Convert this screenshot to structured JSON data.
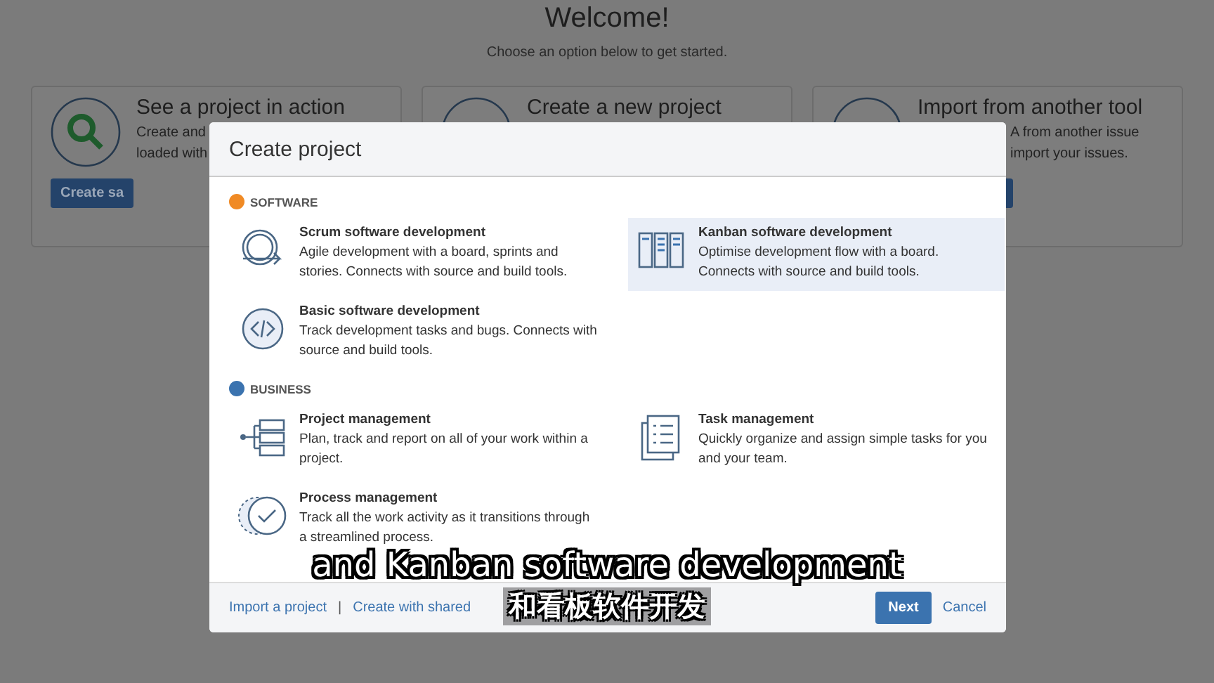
{
  "page": {
    "title": "Welcome!",
    "subtitle": "Choose an option below to get started.",
    "cards": [
      {
        "kind": "search",
        "title": "See a project in action",
        "lines": [
          "Create and",
          "loaded with"
        ],
        "button": "Create sa"
      },
      {
        "kind": "plus",
        "title": "Create a new project"
      },
      {
        "kind": "import",
        "title": "Import from another tool",
        "lines": [
          "A from another issue",
          "import your issues."
        ]
      }
    ]
  },
  "dialog": {
    "title": "Create project",
    "sections": [
      {
        "heading": "SOFTWARE",
        "color": "#f08a24",
        "items": [
          {
            "kind": "scrum",
            "title": "Scrum software development",
            "description": "Agile development with a board, sprints and stories. Connects with source and build tools.",
            "selected": false
          },
          {
            "kind": "kanban",
            "title": "Kanban software development",
            "description": "Optimise development flow with a board. Connects with source and build tools.",
            "selected": true
          },
          {
            "kind": "basic",
            "title": "Basic software development",
            "description": "Track development tasks and bugs. Connects with source and build tools.",
            "selected": false
          }
        ]
      },
      {
        "heading": "BUSINESS",
        "color": "#3b73af",
        "items": [
          {
            "kind": "project",
            "title": "Project management",
            "description": "Plan, track and report on all of your work within a project.",
            "selected": false
          },
          {
            "kind": "task",
            "title": "Task management",
            "description": "Quickly organize and assign simple tasks for you and your team.",
            "selected": false
          },
          {
            "kind": "process",
            "title": "Process management",
            "description": "Track all the work activity as it transitions through a streamlined process.",
            "selected": false
          }
        ]
      }
    ],
    "footer": {
      "links": [
        "Import a project",
        "Create with shared"
      ],
      "separator": "|",
      "primary": "Next",
      "cancel": "Cancel"
    }
  },
  "subtitles": [
    "and Kanban software development",
    "和看板软件开发"
  ]
}
